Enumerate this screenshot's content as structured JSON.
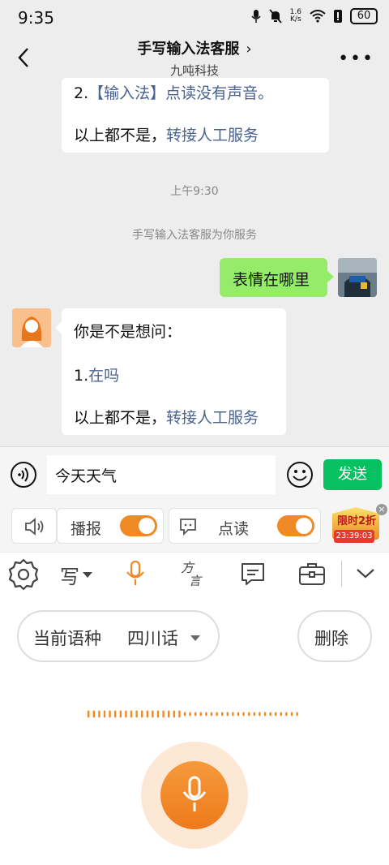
{
  "status_bar": {
    "time": "9:35",
    "net_speed_value": "1.6",
    "net_speed_unit": "K/s",
    "battery": "60"
  },
  "header": {
    "title": "手写输入法客服",
    "subtitle": "九吨科技"
  },
  "chat": {
    "prev_message": {
      "item2_prefix": "2.",
      "item2_link": "【输入法】点读没有声音。",
      "footer_text": "以上都不是，",
      "footer_link": "转接人工服务"
    },
    "timestamp": "上午9:30",
    "system_notice": "手写输入法客服为你服务",
    "user_message": "表情在哪里",
    "bot_reply": {
      "intro": "你是不是想问：",
      "item1_prefix": "1.",
      "item1_link": "在吗",
      "footer_text": "以上都不是，",
      "footer_link": "转接人工服务"
    }
  },
  "input_bar": {
    "input_value": "今天天气",
    "send_label": "发送"
  },
  "keyboard_bar": {
    "broadcast_label": "播报",
    "broadcast_on": true,
    "read_label": "点读",
    "read_on": true,
    "promo_label": "限时2折",
    "promo_timer": "23:39:03"
  },
  "keyboard_toolbar": {
    "write_label": "写"
  },
  "voice_panel": {
    "language_label": "当前语种",
    "language_value": "四川话",
    "delete_label": "删除"
  },
  "colors": {
    "accent_orange": "#f08a24",
    "send_green": "#07c160",
    "link_blue": "#4a6391",
    "bubble_green": "#95ec69"
  }
}
